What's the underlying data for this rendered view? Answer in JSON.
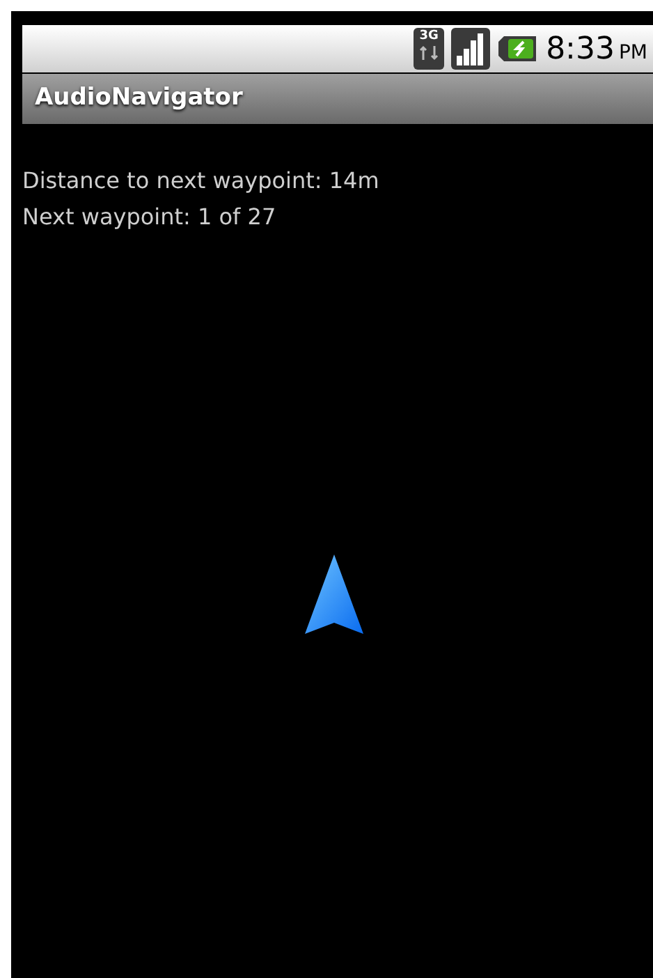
{
  "status_bar": {
    "network": "3G",
    "time": "8:33",
    "meridiem": "PM"
  },
  "window": {
    "title": "AudioNavigator"
  },
  "info_lines": [
    "Distance to next waypoint: 14m",
    "Next waypoint: 1 of 27"
  ]
}
